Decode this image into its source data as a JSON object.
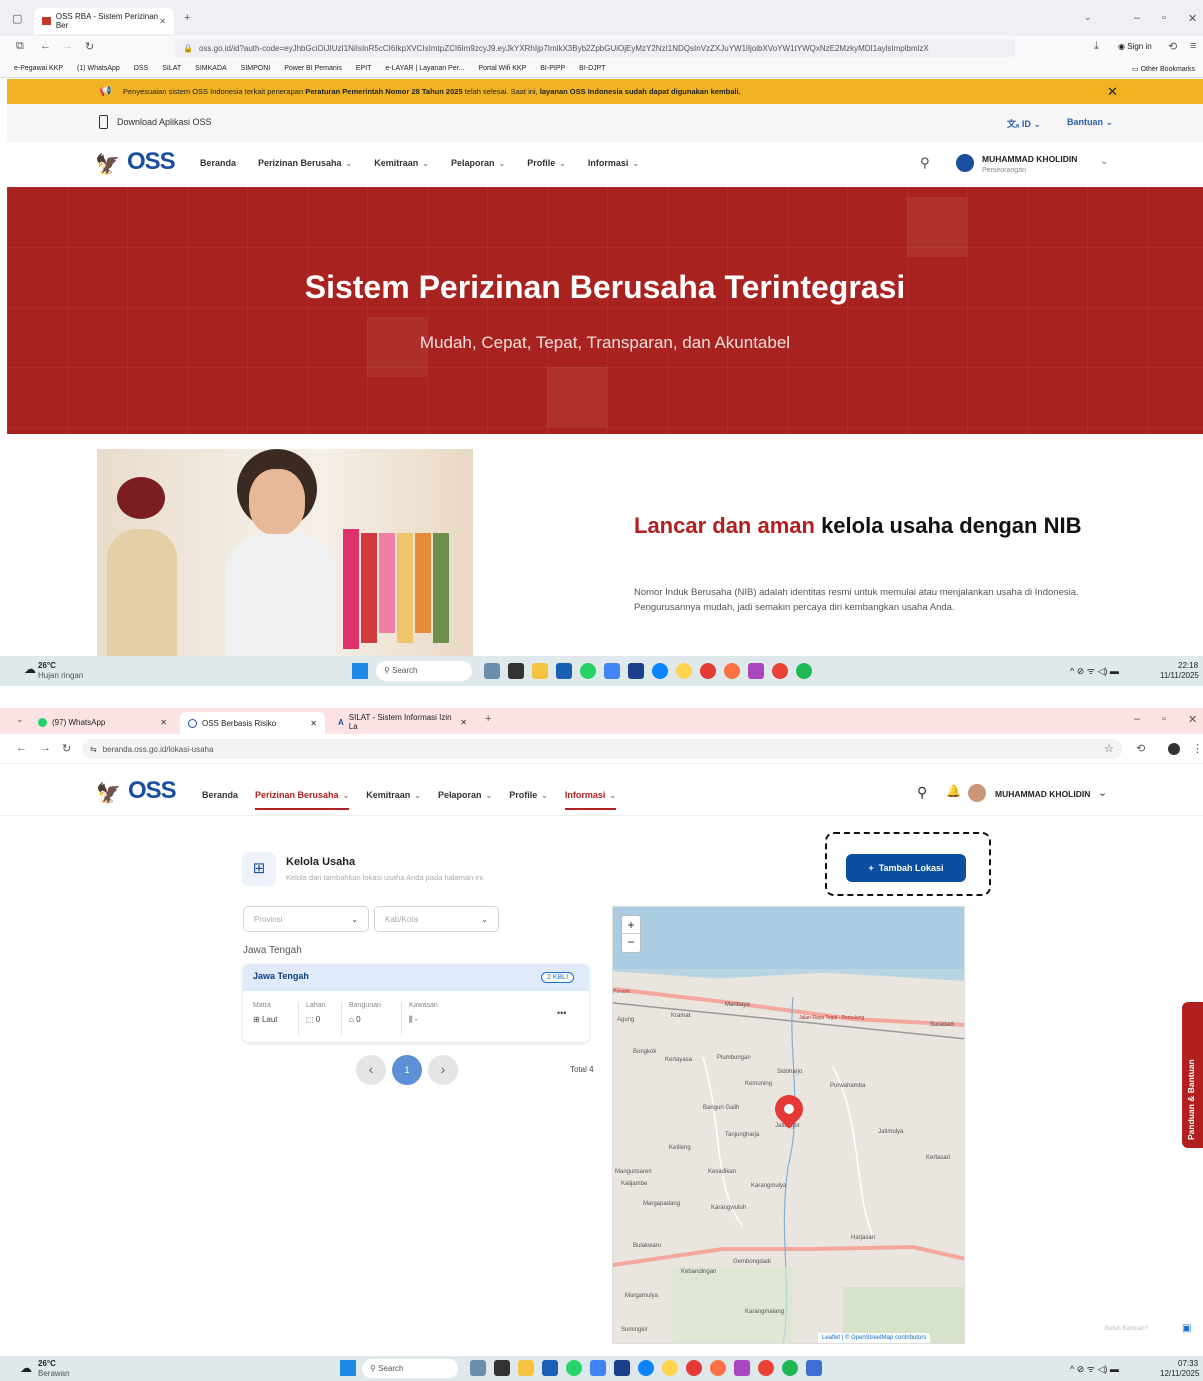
{
  "screen1": {
    "browser": {
      "tab_title": "OSS RBA - Sistem Perizinan Ber",
      "url": "oss.go.id/id?auth-code=eyJhbGciOiJIUzI1NiIsInR5cCI6IkpXVCIsImtpZCI6Im9zcyJ9.eyJkYXRhIjp7ImlkX3Byb2ZpbGUiOjEyMzY2NzI1NDQsInVzZXJuYW1lIjoibXVoYW1tYWQxNzE2MzkyMDI1aylsImplbmlzX",
      "sign_in": "Sign in",
      "bookmarks": [
        "e-Pegawai KKP",
        "(1) WhatsApp",
        "DSS",
        "SILAT",
        "SIMKADA",
        "SIMPONI",
        "Power BI Pemanis",
        "EPIT",
        "e-LAYAR | Layanan Per...",
        "Portal Wifi KKP",
        "BI-PIPP",
        "BI-DJPT"
      ],
      "other_bookmarks": "Other Bookmarks"
    },
    "banner": {
      "text_pre": "Penyesuaian sistem OSS Indonesia terkait penerapan ",
      "text_bold1": "Peraturan Pemerintah Nomor 28 Tahun 2025",
      "text_mid": " telah selesai. Saat ini, ",
      "text_bold2": "layanan OSS Indonesia sudah dapat digunakan kembali.",
      "close": "✕"
    },
    "topbar": {
      "download": "Download Aplikasi OSS",
      "lang": "ID",
      "help": "Bantuan"
    },
    "nav": {
      "logo": "OSS",
      "items": [
        "Beranda",
        "Perizinan Berusaha",
        "Kemitraan",
        "Pelaporan",
        "Profile",
        "Informasi"
      ],
      "user_name": "MUHAMMAD KHOLIDIN",
      "user_role": "Perseorangan"
    },
    "hero": {
      "title": "Sistem Perizinan Berusaha Terintegrasi",
      "subtitle": "Mudah, Cepat, Tepat, Transparan, dan Akuntabel"
    },
    "promo": {
      "heading_red": "Lancar dan aman",
      "heading_dark": " kelola usaha dengan NIB",
      "body": "Nomor Induk Berusaha (NIB) adalah identitas resmi untuk memulai atau menjalankan usaha di Indonesia. Pengurusannya mudah, jadi semakin percaya diri kembangkan usaha Anda."
    },
    "taskbar": {
      "weather_temp": "26°C",
      "weather_desc": "Hujan ringan",
      "search": "Search",
      "time": "22:18",
      "date": "11/11/2025"
    }
  },
  "screen2": {
    "browser": {
      "tabs": [
        "(97) WhatsApp",
        "OSS Berbasis Risiko",
        "SILAT - Sistem Informasi Izin La"
      ],
      "url": "beranda.oss.go.id/lokasi-usaha"
    },
    "nav": {
      "logo": "OSS",
      "items": [
        "Beranda",
        "Perizinan Berusaha",
        "Kemitraan",
        "Pelaporan",
        "Profile",
        "Informasi"
      ],
      "user_name": "MUHAMMAD KHOLIDIN"
    },
    "page": {
      "title": "Kelola Usaha",
      "subtitle": "Kelola dan tambahkan lokasi usaha Anda pada halaman ini.",
      "add_button": "Tambah Lokasi",
      "province_placeholder": "Provinsi",
      "city_placeholder": "Kab/Kota",
      "group_label": "Jawa Tengah",
      "card": {
        "title": "Jawa Tengah",
        "badge": "2 KBLI",
        "columns": [
          {
            "label": "Matra",
            "value": "Laut"
          },
          {
            "label": "Lahan",
            "value": "0"
          },
          {
            "label": "Bangunan",
            "value": "0"
          },
          {
            "label": "Kawasan",
            "value": "-"
          }
        ],
        "more": "•••"
      },
      "pagination": {
        "prev": "‹",
        "current": "1",
        "next": "›",
        "total": "Total 4"
      }
    },
    "map": {
      "zoom_in": "+",
      "zoom_out": "−",
      "attribution": "Leaflet | © OpenStreetMap contributors",
      "places": [
        "Maribaya",
        "Kramat",
        "Suradadi",
        "Agung",
        "Bongkok",
        "Kertayasa",
        "Plumbungan",
        "Sidoharjo",
        "Kemuning",
        "Purwahamba",
        "Bangun Galih",
        "Jatibogor",
        "Tanjungharja",
        "Jatimulya",
        "Ketileng",
        "Kertasari",
        "Mangunsaren",
        "Kesadikan",
        "Kalijambe",
        "Karangmulya",
        "Margapadang",
        "Karangwuluh",
        "Harjasari",
        "Bulakwaru",
        "Gembongdadi",
        "Kebandingan",
        "Margamulya",
        "Karangmalang",
        "Sumingkir",
        "Penarik",
        "Jalan Raya Tegal - Pemalang"
      ]
    },
    "side_tab": "Panduan & Bantuan",
    "help_link": "Butuh Bantuan?",
    "taskbar": {
      "weather_temp": "26°C",
      "weather_desc": "Berawan",
      "search": "Search",
      "time": "07:33",
      "date": "12/11/2025"
    }
  }
}
